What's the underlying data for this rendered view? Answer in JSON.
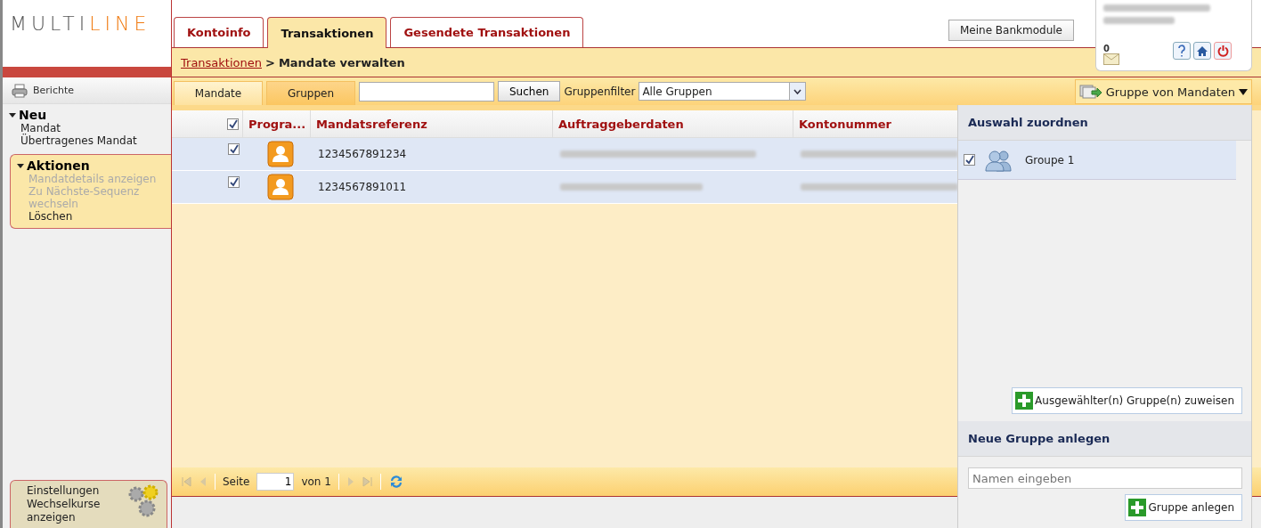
{
  "logo": {
    "part_a": "MULTI",
    "part_b": "LINE"
  },
  "tabs": [
    {
      "label": "Kontoinfo",
      "selected": false
    },
    {
      "label": "Transaktionen",
      "selected": true
    },
    {
      "label": "Gesendete Transaktionen",
      "selected": false
    }
  ],
  "header_button": "Meine Bankmodule",
  "user_box": {
    "mail_count": "0"
  },
  "breadcrumb": {
    "link": "Transaktionen",
    "separator": ">",
    "current": "Mandate verwalten"
  },
  "sidebar": {
    "reports": "Berichte",
    "sections": [
      {
        "title": "Neu",
        "expanded": true,
        "highlighted": false,
        "items": [
          {
            "label": "Mandat",
            "disabled": false
          },
          {
            "label": "Übertragenes Mandat",
            "disabled": false
          }
        ]
      },
      {
        "title": "Aktionen",
        "expanded": true,
        "highlighted": true,
        "items": [
          {
            "label": "Mandatdetails anzeigen",
            "disabled": true
          },
          {
            "label": "Zu Nächste-Sequenz wechseln",
            "disabled": true
          },
          {
            "label": "Löschen",
            "disabled": false
          }
        ]
      }
    ],
    "settings": [
      "Einstellungen",
      "Wechselkurse anzeigen"
    ]
  },
  "subtabs": [
    {
      "label": "Mandate",
      "selected": true
    },
    {
      "label": "Gruppen",
      "selected": false
    }
  ],
  "search_button": "Suchen",
  "filter_label": "Gruppenfilter",
  "filter_value": "Alle Gruppen",
  "group_menu": "Gruppe von Mandaten",
  "table": {
    "all_checked": true,
    "columns": [
      "Progra...",
      "Mandatsreferenz",
      "Auftraggeberdaten",
      "Kontonummer"
    ],
    "rows": [
      {
        "checked": true,
        "selected": true,
        "reference": "1234567891234"
      },
      {
        "checked": true,
        "selected": true,
        "reference": "1234567891011"
      }
    ]
  },
  "pager": {
    "page_label": "Seite",
    "page": "1",
    "of": "von 1"
  },
  "panel": {
    "title": "Auswahl zuordnen",
    "groups": [
      {
        "name": "Groupe 1",
        "checked": true
      }
    ],
    "assign_button": "Ausgewählter(n) Gruppe(n) zuweisen",
    "new_title": "Neue Gruppe anlegen",
    "name_placeholder": "Namen eingeben",
    "create_button": "Gruppe anlegen"
  }
}
